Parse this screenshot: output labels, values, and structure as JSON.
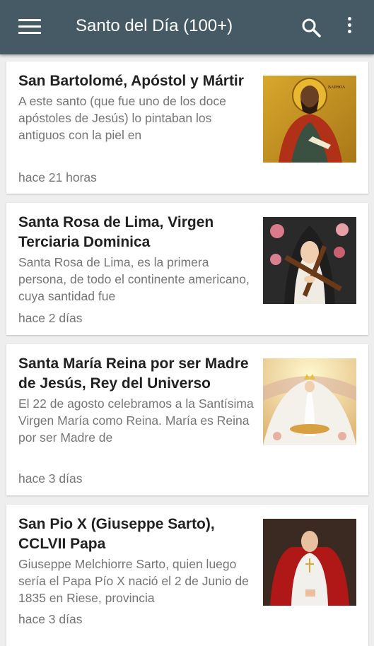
{
  "appbar": {
    "title": "Santo del Día (100+)",
    "menu_icon": "hamburger-menu-icon",
    "search_icon": "search-icon",
    "more_icon": "more-vert-icon",
    "color": "#455a64"
  },
  "items": [
    {
      "title": "San Bartolomé, Apóstol y Mártir",
      "excerpt": "A este santo (que fue uno de los doce apóstoles de Jesús) lo pintaban los antiguos con la piel en",
      "time": "hace 21 horas"
    },
    {
      "title": "Santa Rosa de Lima, Virgen Terciaria Dominica",
      "excerpt": "Santa Rosa de Lima, es la primera persona, de todo el continente americano, cuya santidad fue",
      "time": "hace 2 días"
    },
    {
      "title": "Santa María Reina por ser Madre de Jesús, Rey del Universo",
      "excerpt": "El 22 de agosto celebramos a la Santísima Virgen María como Reina. María es Reina por ser Madre de",
      "time": "hace 3 días"
    },
    {
      "title": "San Pio X (Giuseppe Sarto), CCLVII Papa",
      "excerpt": "Giuseppe Melchiorre Sarto, quien luego sería el Papa Pío X nació el 2 de Junio de 1835 en Riese, provincia",
      "time": "hace 3 días"
    }
  ]
}
